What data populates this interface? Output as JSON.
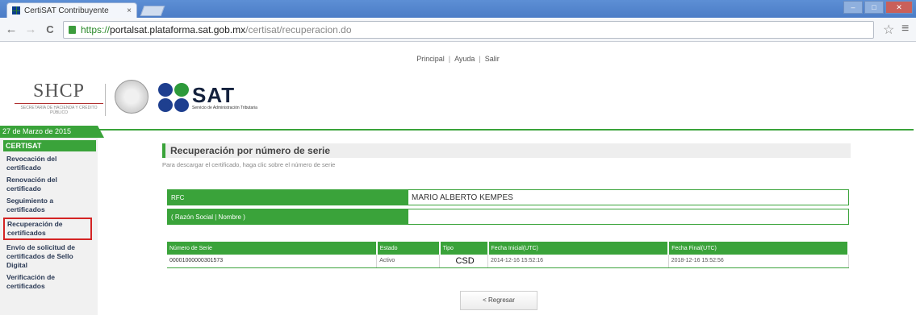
{
  "browser": {
    "tab_title": "CertiSAT Contribuyente",
    "tab_close": "×",
    "url_scheme": "https://",
    "url_host": "portalsat.plataforma.sat.gob.mx",
    "url_path": "/certisat/recuperacion.do",
    "star": "☆",
    "menu": "≡",
    "back": "←",
    "forward": "→",
    "reload": "C"
  },
  "topnav": {
    "principal": "Principal",
    "ayuda": "Ayuda",
    "salir": "Salir",
    "sep": "|"
  },
  "logos": {
    "shcp": "SHCP",
    "shcp_sub": "SECRETARÍA DE HACIENDA Y CRÉDITO PÚBLICO",
    "sat": "SAT",
    "sat_sub": "Servicio de Administración Tributaria"
  },
  "sidebar": {
    "date": "27 de Marzo de 2015",
    "section": "CERTISAT",
    "items": [
      {
        "label": "Revocación del certificado"
      },
      {
        "label": "Renovación del certificado"
      },
      {
        "label": "Seguimiento a certificados"
      },
      {
        "label": "Recuperación de certificados"
      },
      {
        "label": "Envío de solicitud de certificados de Sello Digital"
      },
      {
        "label": "Verificación de certificados"
      }
    ]
  },
  "main": {
    "title": "Recuperación por número de serie",
    "instruction": "Para descargar el certificado, haga clic sobre el número de serie",
    "rfc_label": "RFC",
    "rfc_value": "MARIO ALBERTO KEMPES",
    "razon_label": "( Razón Social | Nombre )",
    "razon_value": "",
    "table": {
      "headers": [
        "Número de Serie",
        "Estado",
        "Tipo",
        "Fecha Inicial(UTC)",
        "Fecha Final(UTC)"
      ],
      "rows": [
        [
          "00001000000301573",
          "Activo",
          "CSD",
          "2014-12-16 15:52:16",
          "2018-12-16 15:52:56"
        ]
      ]
    },
    "regresar": "< Regresar"
  }
}
